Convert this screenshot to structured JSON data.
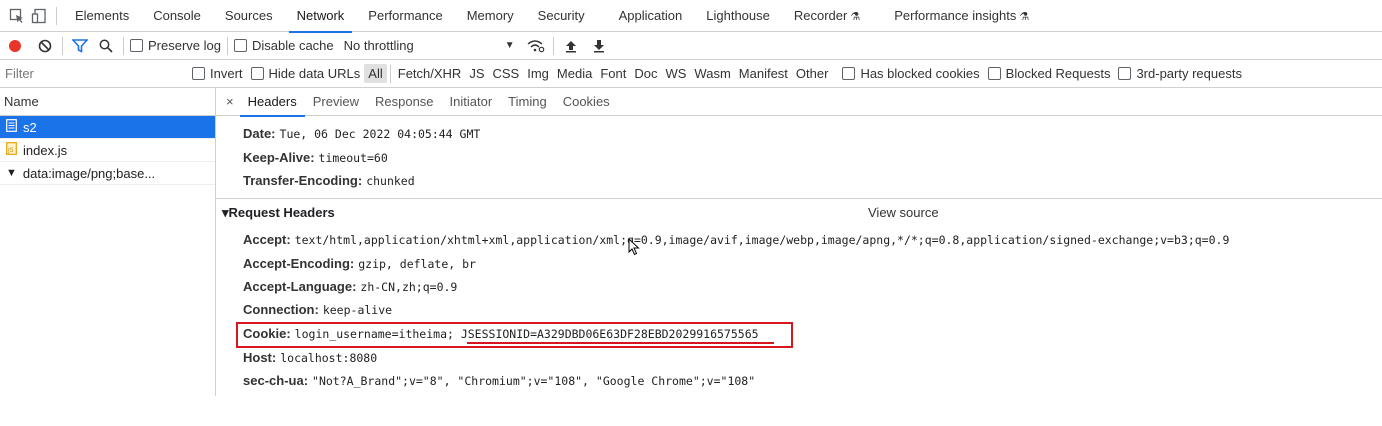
{
  "tabs": [
    "Elements",
    "Console",
    "Sources",
    "Network",
    "Performance",
    "Memory",
    "Security",
    "Application",
    "Lighthouse",
    "Recorder",
    "Performance insights"
  ],
  "toolbar": {
    "preserve_log": "Preserve log",
    "disable_cache": "Disable cache",
    "throttling": "No throttling"
  },
  "filter": {
    "placeholder": "Filter",
    "invert": "Invert",
    "hide_data_urls": "Hide data URLs",
    "types": [
      "All",
      "Fetch/XHR",
      "JS",
      "CSS",
      "Img",
      "Media",
      "Font",
      "Doc",
      "WS",
      "Wasm",
      "Manifest",
      "Other"
    ],
    "has_blocked_cookies": "Has blocked cookies",
    "blocked_requests": "Blocked Requests",
    "third_party": "3rd-party requests"
  },
  "list": {
    "header": "Name",
    "items": [
      "s2",
      "index.js",
      "data:image/png;base..."
    ]
  },
  "detail": {
    "close": "×",
    "tabs": [
      "Headers",
      "Preview",
      "Response",
      "Initiator",
      "Timing",
      "Cookies"
    ],
    "response_headers": [
      {
        "name": "Date:",
        "value": "Tue, 06 Dec 2022 04:05:44 GMT"
      },
      {
        "name": "Keep-Alive:",
        "value": "timeout=60"
      },
      {
        "name": "Transfer-Encoding:",
        "value": "chunked"
      }
    ],
    "request_section": {
      "title": "▾Request Headers",
      "view_source": "View source"
    },
    "request_headers": [
      {
        "name": "Accept:",
        "value": "text/html,application/xhtml+xml,application/xml;q=0.9,image/avif,image/webp,image/apng,*/*;q=0.8,application/signed-exchange;v=b3;q=0.9"
      },
      {
        "name": "Accept-Encoding:",
        "value": "gzip, deflate, br"
      },
      {
        "name": "Accept-Language:",
        "value": "zh-CN,zh;q=0.9"
      },
      {
        "name": "Connection:",
        "value": "keep-alive"
      },
      {
        "name": "Cookie:",
        "value": "login_username=itheima; JSESSIONID=A329DBD06E63DF28EBD2029916575565"
      },
      {
        "name": "Host:",
        "value": "localhost:8080"
      },
      {
        "name": "sec-ch-ua:",
        "value": "\"Not?A_Brand\";v=\"8\", \"Chromium\";v=\"108\", \"Google Chrome\";v=\"108\""
      }
    ]
  },
  "colors": {
    "accent": "#1a73e8",
    "record": "#e8352a",
    "highlight": "#d6181e"
  }
}
